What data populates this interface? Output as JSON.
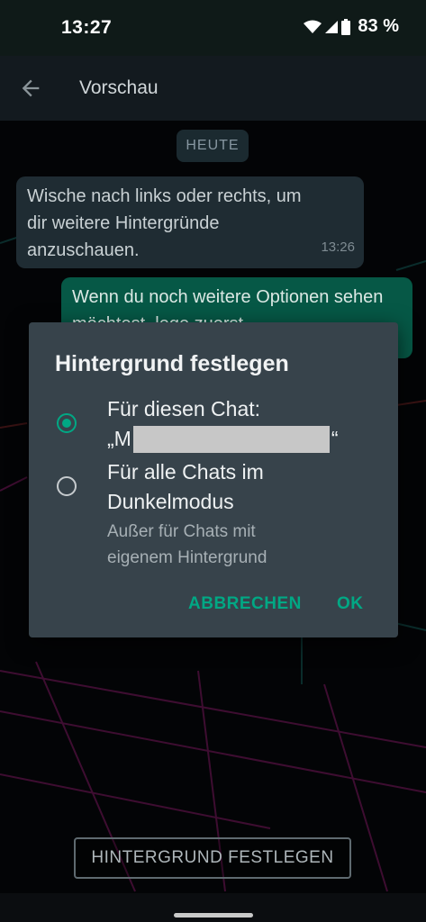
{
  "status_bar": {
    "time": "13:27",
    "battery": "83 %",
    "icons": [
      "wifi-icon",
      "signal-icon",
      "battery-icon"
    ]
  },
  "app_bar": {
    "title": "Vorschau",
    "back_icon": "back-arrow-icon"
  },
  "chat": {
    "date_chip": "HEUTE",
    "incoming": {
      "text": "Wische nach links oder rechts, um dir weitere Hintergründe anzuschauen.",
      "time": "13:26"
    },
    "outgoing": {
      "text": "Wenn du noch weitere Optionen sehen möchtest, lege zuerst"
    }
  },
  "dialog": {
    "title": "Hintergrund festlegen",
    "options": [
      {
        "label_line1": "Für diesen Chat:",
        "label_line2_prefix": "„M",
        "label_line2_suffix": "“",
        "selected": true
      },
      {
        "label_line1": "Für alle Chats im",
        "label_line2": "Dunkelmodus",
        "sub_line1": "Außer für Chats mit",
        "sub_line2": "eigenem Hintergrund",
        "selected": false
      }
    ],
    "cancel_label": "ABBRECHEN",
    "ok_label": "OK"
  },
  "bottom_button": {
    "label": "HINTERGRUND FESTLEGEN"
  },
  "colors": {
    "accent": "#00a884",
    "dialog_bg": "#37434b",
    "app_bar": "#131a1f"
  }
}
